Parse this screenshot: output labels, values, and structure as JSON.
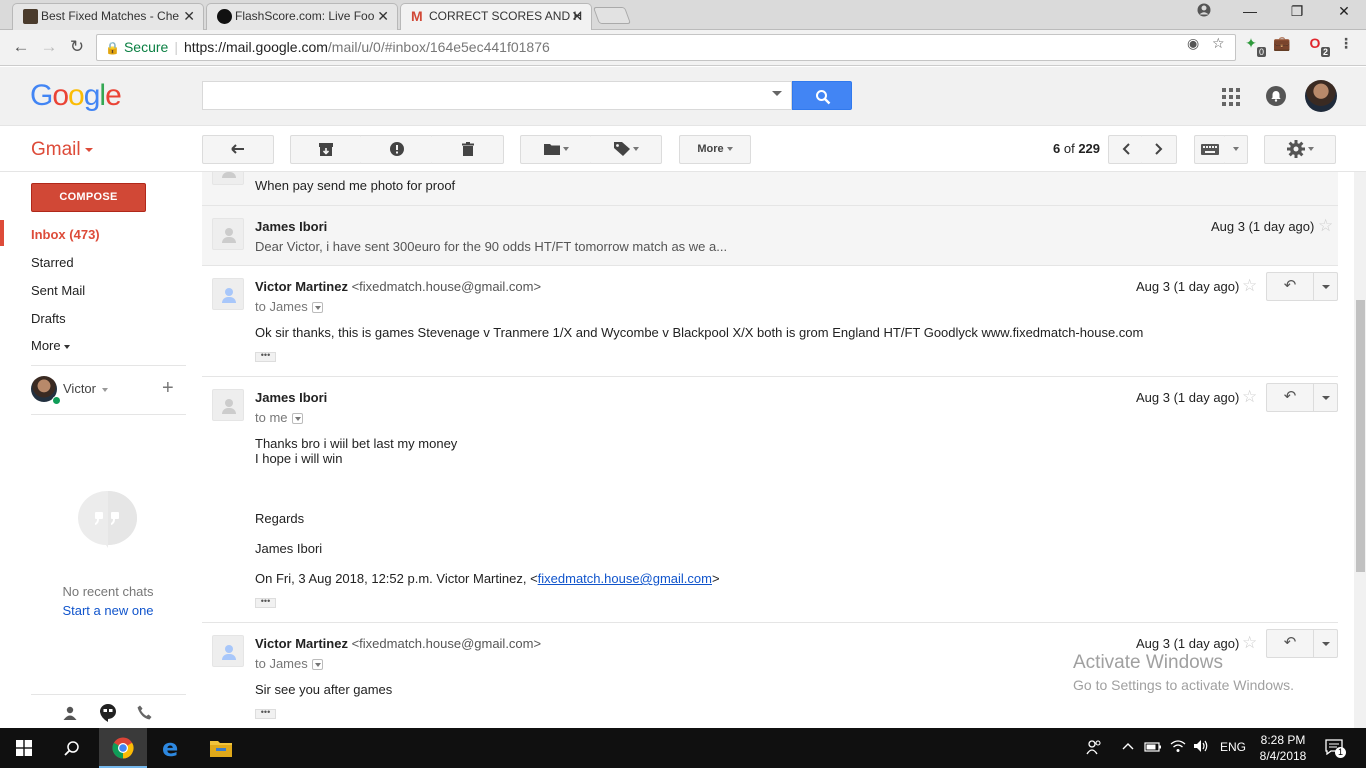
{
  "browser": {
    "tabs": [
      {
        "title": "Best Fixed Matches - Che",
        "active": false
      },
      {
        "title": "FlashScore.com: Live Foo",
        "active": false
      },
      {
        "title": "CORRECT SCORES AND H",
        "active": true
      }
    ],
    "address": {
      "secure_label": "Secure",
      "url_host": "https://mail.google.com",
      "url_path": "/mail/u/0/#inbox/164e5ec441f01876"
    },
    "extension_badges": [
      "0",
      "2"
    ]
  },
  "gmail": {
    "logo": {
      "G": "G",
      "o1": "o",
      "o2": "o",
      "g": "g",
      "l": "l",
      "e": "e"
    },
    "product_label": "Gmail",
    "toolbar": {
      "more_label": "More",
      "pager_current": "6",
      "pager_of": " of ",
      "pager_total": "229"
    },
    "sidebar": {
      "compose_label": "COMPOSE",
      "items": [
        {
          "label": "Inbox (473)",
          "selected": true
        },
        {
          "label": "Starred"
        },
        {
          "label": "Sent Mail"
        },
        {
          "label": "Drafts"
        },
        {
          "label": "More"
        }
      ],
      "user_name": "Victor",
      "add_label": "+",
      "no_chats": "No recent chats",
      "start_new": "Start a new one"
    },
    "messages": [
      {
        "state": "collapsed-partial",
        "snippet": "When pay send me photo for proof"
      },
      {
        "state": "collapsed",
        "sender": "James Ibori",
        "date": "Aug 3 (1 day ago)",
        "snippet": "Dear Victor, i have sent 300euro for the 90 odds HT/FT tomorrow match as we a..."
      },
      {
        "state": "expanded",
        "sender": "Victor Martinez",
        "sender_email": "<fixedmatch.house@gmail.com>",
        "to": "to James",
        "date": "Aug 3 (1 day ago)",
        "body": [
          "Ok sir thanks, this is games Stevenage v Tranmere 1/X and Wycombe v Blackpool X/X both is grom England HT/FT Goodlyck www.fixedmatch-house.com"
        ]
      },
      {
        "state": "expanded",
        "sender": "James Ibori",
        "to": "to me",
        "date": "Aug 3 (1 day ago)",
        "body": [
          "Thanks bro i wiil bet last my money",
          "I hope i will win",
          "Regards",
          "James Ibori"
        ],
        "quote_prefix": "On Fri, 3 Aug 2018, 12:52 p.m. Victor Martinez, <",
        "quote_link": "fixedmatch.house@gmail.com",
        "quote_suffix": ">"
      },
      {
        "state": "expanded",
        "sender": "Victor Martinez",
        "sender_email": "<fixedmatch.house@gmail.com>",
        "to": "to James",
        "date": "Aug 3 (1 day ago)",
        "body": [
          "Sir see you after games"
        ]
      }
    ],
    "ellipsis": "•••"
  },
  "watermark": {
    "line1": "Activate Windows",
    "line2": "Go to Settings to activate Windows."
  },
  "taskbar": {
    "language": "ENG",
    "time": "8:28 PM",
    "date": "8/4/2018",
    "notification_count": "1"
  },
  "colors": {
    "gmail_red": "#dd4b39",
    "compose_red": "#d14836",
    "search_blue": "#4285f4",
    "link_blue": "#1155cc"
  }
}
